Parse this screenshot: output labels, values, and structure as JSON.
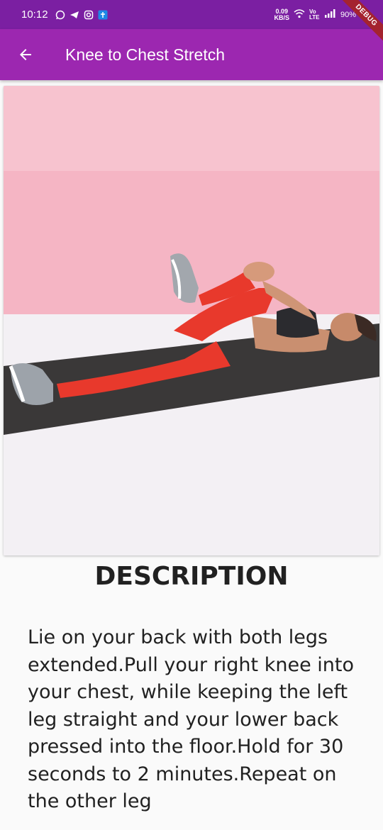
{
  "status_bar": {
    "time": "10:12",
    "net_speed_value": "0.09",
    "net_speed_unit": "KB/S",
    "network": "Vo LTE",
    "battery": "90%",
    "debug_label": "DEBUG"
  },
  "app_bar": {
    "title": "Knee to Chest Stretch",
    "back_icon": "arrow-back-icon",
    "color": "#9c27b0"
  },
  "exercise": {
    "image_semantic": "woman-lying-on-mat-knee-to-chest-stretch",
    "heading": "DESCRIPTION",
    "description": "Lie on your back with both legs extended.Pull your right knee into your chest, while keeping the left leg straight and your lower back pressed into the floor.Hold for 30 seconds to 2 minutes.Repeat on the other leg"
  }
}
